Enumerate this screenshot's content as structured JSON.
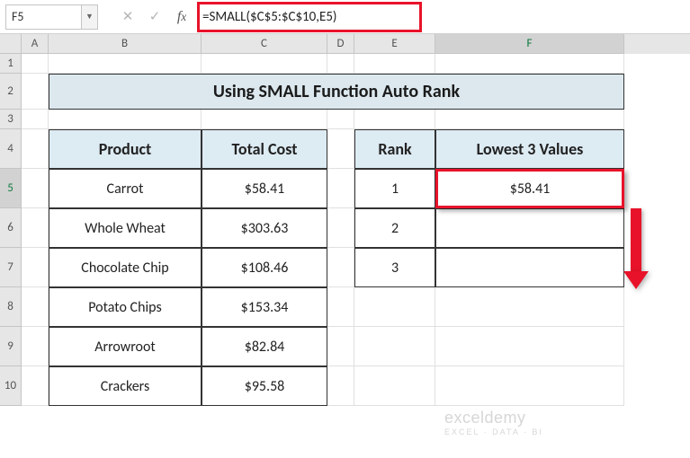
{
  "nameBox": "F5",
  "formula": "=SMALL($C$5:$C$10,E5)",
  "columns": [
    "A",
    "B",
    "C",
    "D",
    "E",
    "F"
  ],
  "rows": [
    "1",
    "2",
    "3",
    "4",
    "5",
    "6",
    "7",
    "8",
    "9",
    "10"
  ],
  "title": "Using SMALL Function Auto Rank",
  "table1": {
    "headers": {
      "product": "Product",
      "cost": "Total Cost"
    },
    "rows": [
      {
        "product": "Carrot",
        "cost": "$58.41"
      },
      {
        "product": "Whole Wheat",
        "cost": "$303.63"
      },
      {
        "product": "Chocolate Chip",
        "cost": "$108.46"
      },
      {
        "product": "Potato Chips",
        "cost": "$153.34"
      },
      {
        "product": "Arrowroot",
        "cost": "$82.84"
      },
      {
        "product": "Crackers",
        "cost": "$95.58"
      }
    ]
  },
  "table2": {
    "headers": {
      "rank": "Rank",
      "lowest": "Lowest 3 Values"
    },
    "rows": [
      {
        "rank": "1",
        "value": "$58.41"
      },
      {
        "rank": "2",
        "value": ""
      },
      {
        "rank": "3",
        "value": ""
      }
    ]
  },
  "watermark": {
    "brand": "exceldemy",
    "tag": "EXCEL · DATA · BI"
  },
  "colors": {
    "highlight": "#e8132a",
    "selection": "#217346",
    "header_bg": "#ddebf3",
    "title_bg": "#dce8ee"
  },
  "chart_data": {
    "type": "table",
    "title": "Using SMALL Function Auto Rank",
    "tables": [
      {
        "name": "products",
        "columns": [
          "Product",
          "Total Cost"
        ],
        "rows": [
          [
            "Carrot",
            58.41
          ],
          [
            "Whole Wheat",
            303.63
          ],
          [
            "Chocolate Chip",
            108.46
          ],
          [
            "Potato Chips",
            153.34
          ],
          [
            "Arrowroot",
            82.84
          ],
          [
            "Crackers",
            95.58
          ]
        ]
      },
      {
        "name": "lowest",
        "columns": [
          "Rank",
          "Lowest 3 Values"
        ],
        "rows": [
          [
            1,
            58.41
          ],
          [
            2,
            null
          ],
          [
            3,
            null
          ]
        ]
      }
    ]
  }
}
